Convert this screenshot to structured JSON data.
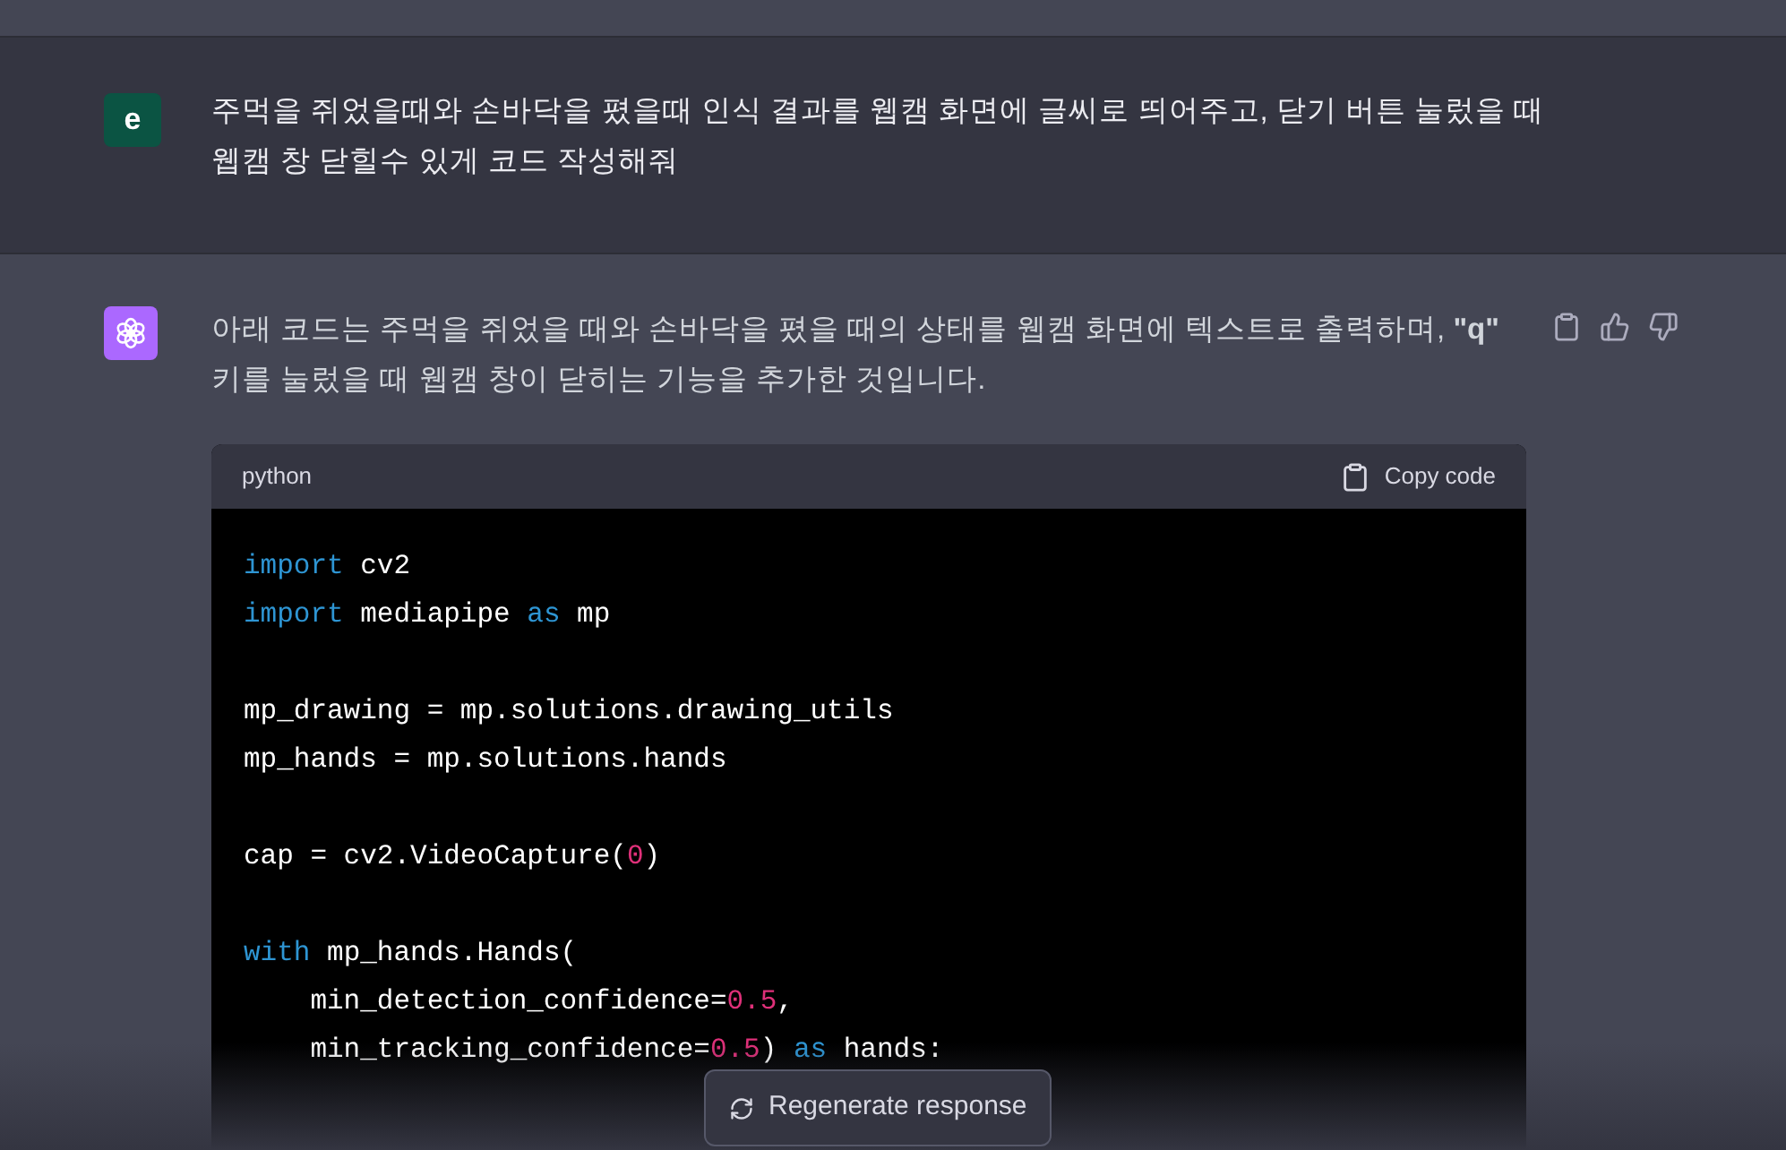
{
  "user_message": {
    "avatar": "e",
    "text": "주먹을 쥐었을때와 손바닥을 폈을때 인식 결과를 웹캠 화면에 글씨로 띄어주고, 닫기 버튼 눌렀을 때 웹캠 창 닫힐수 있게 코드 작성해줘"
  },
  "assistant_message": {
    "text": "아래 코드는 주먹을 쥐었을 때와 손바닥을 폈을 때의 상태를 웹캠 화면에 텍스트로 출력하며, **\"q\"** 키를 눌렀을 때 웹캠 창이 닫히는 기능을 추가한 것입니다.",
    "code_block": {
      "language": "python",
      "copy_label": "Copy code",
      "blocks": [
        [
          [
            {
              "kind": "keyword",
              "text": "import"
            },
            {
              "kind": "plain",
              "text": " cv2"
            }
          ],
          [
            {
              "kind": "keyword",
              "text": "import"
            },
            {
              "kind": "plain",
              "text": " mediapipe "
            },
            {
              "kind": "keyword",
              "text": "as"
            },
            {
              "kind": "plain",
              "text": " mp"
            }
          ]
        ],
        [
          [
            {
              "kind": "plain",
              "text": "mp_drawing = mp.solutions.drawing_utils"
            }
          ],
          [
            {
              "kind": "plain",
              "text": "mp_hands = mp.solutions.hands"
            }
          ]
        ],
        [
          [
            {
              "kind": "plain",
              "text": "cap = cv2.VideoCapture("
            },
            {
              "kind": "number",
              "text": "0"
            },
            {
              "kind": "plain",
              "text": ")"
            }
          ]
        ],
        [
          [
            {
              "kind": "keyword",
              "text": "with"
            },
            {
              "kind": "plain",
              "text": " mp_hands.Hands("
            }
          ],
          [
            {
              "kind": "plain",
              "text": "    min_detection_confidence="
            },
            {
              "kind": "number",
              "text": "0.5"
            },
            {
              "kind": "plain",
              "text": ","
            }
          ],
          [
            {
              "kind": "plain",
              "text": "    min_tracking_confidence="
            },
            {
              "kind": "number",
              "text": "0.5"
            },
            {
              "kind": "plain",
              "text": ") "
            },
            {
              "kind": "keyword",
              "text": "as"
            },
            {
              "kind": "plain",
              "text": " hands:"
            }
          ]
        ]
      ]
    }
  },
  "regenerate_button": "Regenerate response"
}
